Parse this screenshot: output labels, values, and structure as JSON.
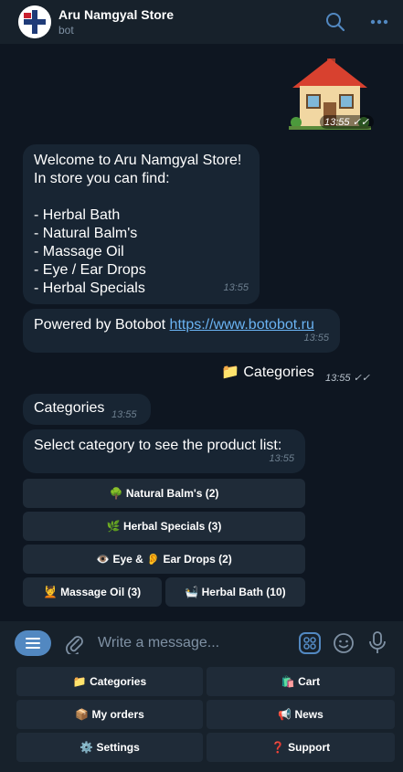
{
  "header": {
    "title": "Aru Namgyal Store",
    "subtitle": "bot",
    "icons": [
      "search-icon",
      "more-icon"
    ]
  },
  "messages": {
    "sticker_time": "13:55",
    "welcome": {
      "lines": [
        "Welcome to Aru Namgyal Store!",
        "In store you can find:",
        "",
        "- Herbal Bath",
        "- Natural Balm's",
        "- Massage Oil",
        "- Eye / Ear Drops",
        "- Herbal Specials"
      ],
      "time": "13:55"
    },
    "powered": {
      "text": "Powered by Botobot ",
      "link": "https://www.botobot.ru",
      "time": "13:55"
    },
    "outgoing": {
      "text": "📁 Categories",
      "time": "13:55"
    },
    "categories": {
      "text": "Categories",
      "time": "13:55"
    },
    "select": {
      "text": "Select category to see the product list:",
      "time": "13:55"
    }
  },
  "inline_keyboard": {
    "natural_balm": "🌳 Natural Balm's (2)",
    "herbal_specials": "🌿 Herbal Specials (3)",
    "eye_ear": "👁️ Eye & 👂 Ear Drops (2)",
    "massage_oil": "💆 Massage Oil (3)",
    "herbal_bath": "🛀 Herbal Bath (10)"
  },
  "composer": {
    "placeholder": "Write a message..."
  },
  "reply_keyboard": {
    "categories": "📁 Categories",
    "cart": "🛍️ Cart",
    "orders": "📦 My orders",
    "news": "📢 News",
    "settings": "⚙️ Settings",
    "support": "❓ Support"
  },
  "colors": {
    "accent": "#5288c1",
    "bubble": "#182533",
    "background": "#0e1621",
    "header": "#17212b",
    "link": "#6ab3f3"
  }
}
